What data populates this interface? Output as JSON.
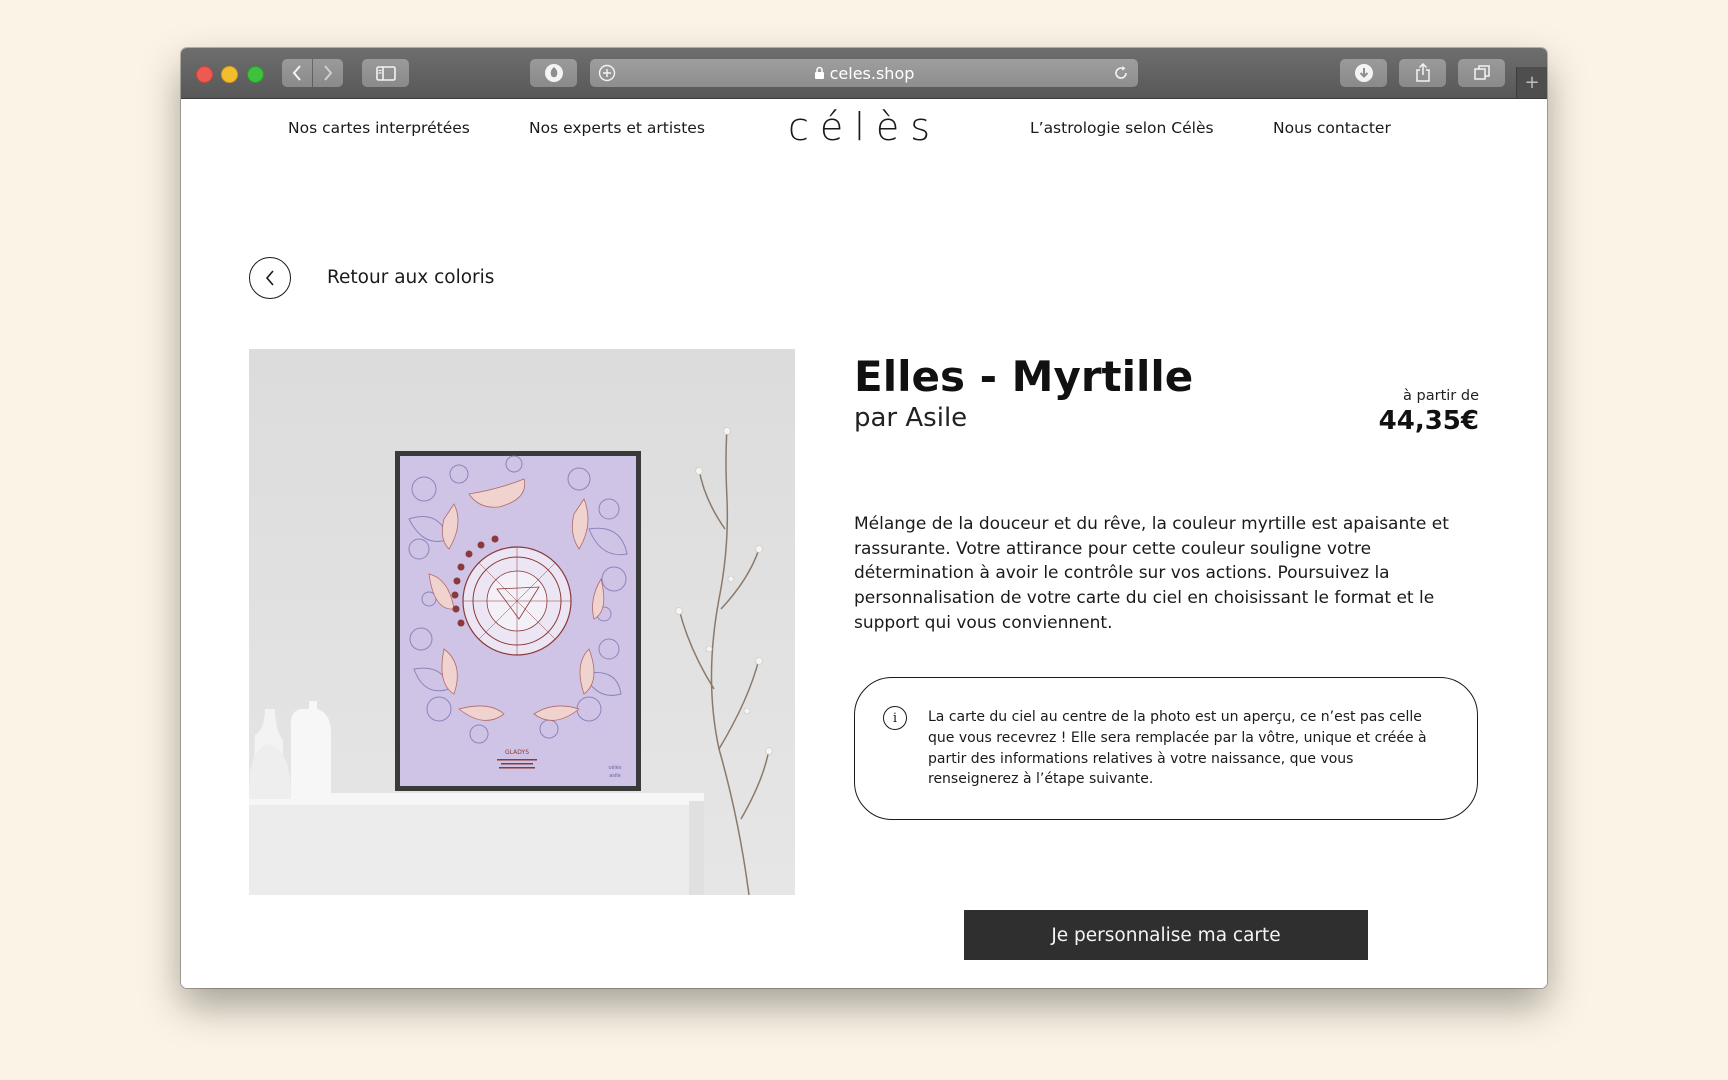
{
  "browser": {
    "url": "celes.shop"
  },
  "nav": {
    "left": [
      "Nos cartes interprétées",
      "Nos experts et artistes"
    ],
    "logo": "célès",
    "right": [
      "L’astrologie selon Célès",
      "Nous contacter"
    ]
  },
  "back": {
    "label": "Retour aux coloris"
  },
  "product": {
    "title": "Elles - Myrtille",
    "artist": "par Asile",
    "price_prefix": "à partir de",
    "price": "44,35€",
    "description": "Mélange de la douceur et du rêve, la couleur myrtille est apaisante et rassurante. Votre attirance pour cette couleur souligne votre détermination à avoir le contrôle sur vos actions. Poursuivez la personnalisation de votre carte du ciel en choisissant le format et le support qui vous conviennent.",
    "poster_name": "GLADYS",
    "poster_brand": "célès",
    "poster_artist": "asile"
  },
  "notice": {
    "icon": "info-icon",
    "text": "La carte du ciel au centre de la photo est un aperçu, ce n’est pas celle que vous recevrez ! Elle sera remplacée par la vôtre, unique et créée à partir des informations relatives à votre naissance, que vous renseignerez à l’étape suivante."
  },
  "cta": {
    "label": "Je personnalise ma carte"
  },
  "colors": {
    "background": "#fbf4e6",
    "poster": "#cfc4e6",
    "cta": "#2f2f2f"
  }
}
